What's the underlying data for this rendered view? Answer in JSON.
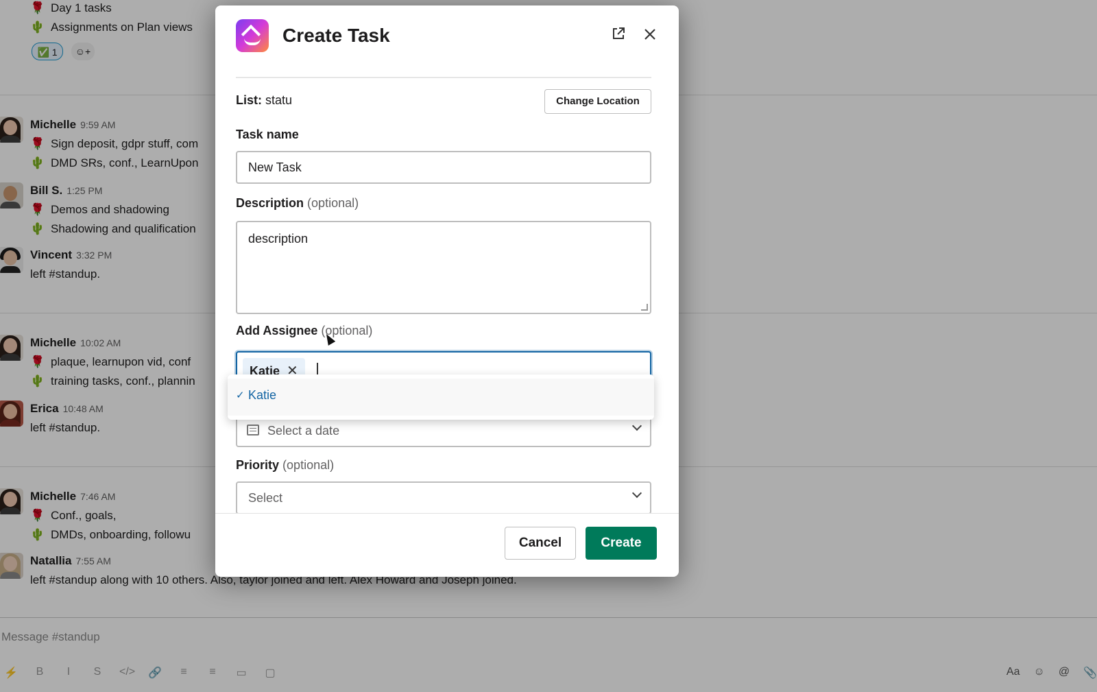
{
  "channel": {
    "top_lines": [
      {
        "emoji": "rose",
        "text": "Day 1 tasks"
      },
      {
        "emoji": "cactus",
        "text": "Assignments on Plan views"
      }
    ],
    "top_reactions": [
      {
        "text": "✅ 1"
      },
      {
        "text": "☺+"
      }
    ],
    "messages": [
      {
        "name": "Michelle",
        "time": "9:59 AM",
        "lines": [
          {
            "emoji": "rose",
            "text": "Sign deposit, gdpr stuff, com"
          },
          {
            "emoji": "cactus",
            "text": "DMD SRs, conf., LearnUpon"
          }
        ]
      },
      {
        "name": "Bill S.",
        "time": "1:25 PM",
        "lines": [
          {
            "emoji": "rose",
            "text": "Demos and shadowing"
          },
          {
            "emoji": "cactus",
            "text": "Shadowing and qualification"
          }
        ]
      },
      {
        "name": "Vincent",
        "time": "3:32 PM",
        "lines": [
          {
            "emoji": "",
            "text": "left #standup."
          }
        ]
      },
      {
        "name": "Michelle",
        "time": "10:02 AM",
        "lines": [
          {
            "emoji": "rose",
            "text": "plaque, learnupon vid, conf"
          },
          {
            "emoji": "cactus",
            "text": "training tasks, conf., plannin"
          }
        ]
      },
      {
        "name": "Erica",
        "time": "10:48 AM",
        "lines": [
          {
            "emoji": "",
            "text": "left #standup."
          }
        ]
      },
      {
        "name": "Michelle",
        "time": "7:46 AM",
        "lines": [
          {
            "emoji": "rose",
            "text": "Conf., goals,"
          },
          {
            "emoji": "cactus",
            "text": "DMDs, onboarding, followu"
          }
        ]
      },
      {
        "name": "Natallia",
        "time": "7:55 AM",
        "lines": [
          {
            "emoji": "",
            "text": "left #standup along with 10 others. Also, taylor joined and left. Alex Howard and Joseph joined."
          }
        ]
      }
    ],
    "composer_placeholder": "Message #standup",
    "format_icons": [
      "⚡",
      "B",
      "I",
      "S",
      "</>",
      "🔗",
      "≡",
      "≡",
      "▭",
      "▢"
    ],
    "right_icons": [
      "Aa",
      "☺",
      "@",
      "📎"
    ]
  },
  "modal": {
    "title": "Create Task",
    "list_label": "List:",
    "list_value": "statu",
    "change_location": "Change Location",
    "task_name_label": "Task name",
    "task_name_value": "New Task",
    "description_label": "Description",
    "optional": "(optional)",
    "description_value": "description",
    "assignee_label": "Add Assignee",
    "assignee_chip": "Katie",
    "dropdown_option": "Katie",
    "date_placeholder": "Select a date",
    "priority_label": "Priority",
    "priority_placeholder": "Select",
    "cancel": "Cancel",
    "create": "Create"
  },
  "colors": {
    "create_button": "#007a5a",
    "focus_border": "#1264a3",
    "selected_option": "#1264a3"
  },
  "icons": {
    "external": "open-in-new-window-icon",
    "close": "close-icon",
    "calendar": "calendar-icon",
    "chevron": "chevron-down-icon",
    "check": "checkmark-icon"
  }
}
